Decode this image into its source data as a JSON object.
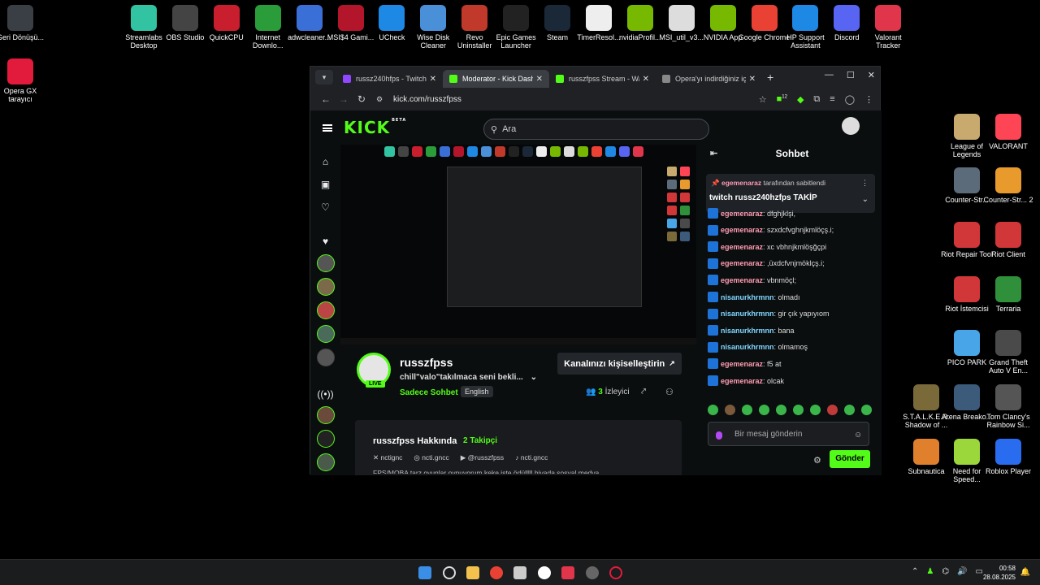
{
  "desktop": {
    "left_icons": [
      {
        "label": "Geri Dönüşü...",
        "icon": "recycle-bin-icon",
        "color": "#3a3f45"
      },
      {
        "label": "Opera GX tarayıcı",
        "icon": "opera-gx-icon",
        "color": "#e21b3c"
      }
    ],
    "top_icons": [
      {
        "label": "Streamlabs Desktop",
        "color": "#31c3a2"
      },
      {
        "label": "OBS Studio",
        "color": "#444"
      },
      {
        "label": "QuickCPU",
        "color": "#c81e2d"
      },
      {
        "label": "Internet Downlo...",
        "color": "#2a9d3a"
      },
      {
        "label": "adwcleaner...",
        "color": "#3a6fd8"
      },
      {
        "label": "MSI$4 Gami...",
        "color": "#b3162b"
      },
      {
        "label": "UCheck",
        "color": "#1e88e5"
      },
      {
        "label": "Wise Disk Cleaner",
        "color": "#4a90d9"
      },
      {
        "label": "Revo Uninstaller",
        "color": "#c0392b"
      },
      {
        "label": "Epic Games Launcher",
        "color": "#222"
      },
      {
        "label": "Steam",
        "color": "#1b2838"
      },
      {
        "label": "TimerResol...",
        "color": "#eee"
      },
      {
        "label": "nvidiaProfil...",
        "color": "#76b900"
      },
      {
        "label": "MSI_util_v3...",
        "color": "#ddd"
      },
      {
        "label": "NVIDIA App",
        "color": "#76b900"
      },
      {
        "label": "Google Chrome",
        "color": "#e94235"
      },
      {
        "label": "HP Support Assistant",
        "color": "#1e88e5"
      },
      {
        "label": "Discord",
        "color": "#5865f2"
      },
      {
        "label": "Valorant Tracker",
        "color": "#e0354a"
      }
    ],
    "right_icons": [
      {
        "label": "League of Legends",
        "color": "#c8aa6e"
      },
      {
        "label": "VALORANT",
        "color": "#fd4556"
      },
      {
        "label": "Counter-Str...",
        "color": "#5c6b7a"
      },
      {
        "label": "Counter-Str... 2",
        "color": "#e89a2c"
      },
      {
        "label": "Riot Repair Tool",
        "color": "#d13639"
      },
      {
        "label": "Riot Client",
        "color": "#d13639"
      },
      {
        "label": "Riot İstemcisi",
        "color": "#d13639"
      },
      {
        "label": "Terraria",
        "color": "#2f8f3a"
      },
      {
        "label": "PICO PARK",
        "color": "#48a6e8"
      },
      {
        "label": "Grand Theft Auto V En...",
        "color": "#4a4a4a"
      },
      {
        "label": "S.T.A.L.K.E.R. Shadow of ...",
        "color": "#7a6a3a"
      },
      {
        "label": "Arena Breako...",
        "color": "#3c5a7a"
      },
      {
        "label": "Tom Clancy's Rainbow Si...",
        "color": "#555"
      },
      {
        "label": "Subnautica",
        "color": "#e0802c"
      },
      {
        "label": "Need for Speed...",
        "color": "#9bd63a"
      },
      {
        "label": "Roblox Player",
        "color": "#2a6cf0"
      }
    ]
  },
  "browser": {
    "tabs": [
      {
        "title": "russz240hfps - Twitch",
        "color": "#9146ff",
        "active": false
      },
      {
        "title": "Moderator - Kick Dashb...",
        "color": "#53fc18",
        "active": true
      },
      {
        "title": "russzfpss Stream - Watc...",
        "color": "#53fc18",
        "active": false
      },
      {
        "title": "Opera'yı indirdiğiniz için...",
        "color": "#888",
        "active": false
      }
    ],
    "url": "kick.com/russzfpss",
    "extension_badge": "12"
  },
  "kick": {
    "logo": "KICK",
    "beta": "BETA",
    "search_placeholder": "Ara",
    "channel": {
      "name": "russzfpss",
      "live": "LIVE",
      "title": "chill\"valo\"takılmaca seni bekli...",
      "category": "Sadece Sohbet",
      "language": "English",
      "customize": "Kanalınızı kişiselleştirin",
      "viewers_count": "3",
      "viewers_label": "İzleyici"
    },
    "about": {
      "title": "russzfpss Hakkında",
      "followers": "2 Takipçi",
      "socials": [
        "nctignc",
        "ncti.gncc",
        "@russzfpss",
        "ncti.gncc"
      ],
      "description": "FPS/MOBA tarz oyunlar oynuyorum keke iste ödülllll hivada sosyal medya"
    },
    "chat": {
      "header": "Sohbet",
      "pinned_by_user": "egemenaraz",
      "pinned_by_suffix": "tarafından sabitlendi",
      "pinned_text": "twitch russz240hzfps TAKİP",
      "messages": [
        {
          "user": "egemenaraz",
          "text": "dfghjklşi,",
          "color": "#ff9cb3"
        },
        {
          "user": "egemenaraz",
          "text": "szxdcfvghnjkmlöçş.i;",
          "color": "#ff9cb3"
        },
        {
          "user": "egemenaraz",
          "text": "xc vbhnjkmlöşğçpi",
          "color": "#ff9cb3"
        },
        {
          "user": "egemenaraz",
          "text": ",üxdcfvnjmöklçş.i;",
          "color": "#ff9cb3"
        },
        {
          "user": "egemenaraz",
          "text": "vbnmöçl;",
          "color": "#ff9cb3"
        },
        {
          "user": "nisanurkhrmnn",
          "text": "olmadı",
          "color": "#7fd6ff"
        },
        {
          "user": "nisanurkhrmnn",
          "text": "gir çık yapıyıom",
          "color": "#7fd6ff"
        },
        {
          "user": "nisanurkhrmnn",
          "text": "bana",
          "color": "#7fd6ff"
        },
        {
          "user": "nisanurkhrmnn",
          "text": "olmamoş",
          "color": "#7fd6ff"
        },
        {
          "user": "egemenaraz",
          "text": "f5 at",
          "color": "#ff9cb3"
        },
        {
          "user": "egemenaraz",
          "text": "olcak",
          "color": "#ff9cb3"
        }
      ],
      "input_placeholder": "Bir mesaj gönderin",
      "send": "Gönder"
    }
  },
  "taskbar": {
    "time": "00:58",
    "date": "28.08.2025",
    "accent": "#53fc18"
  }
}
